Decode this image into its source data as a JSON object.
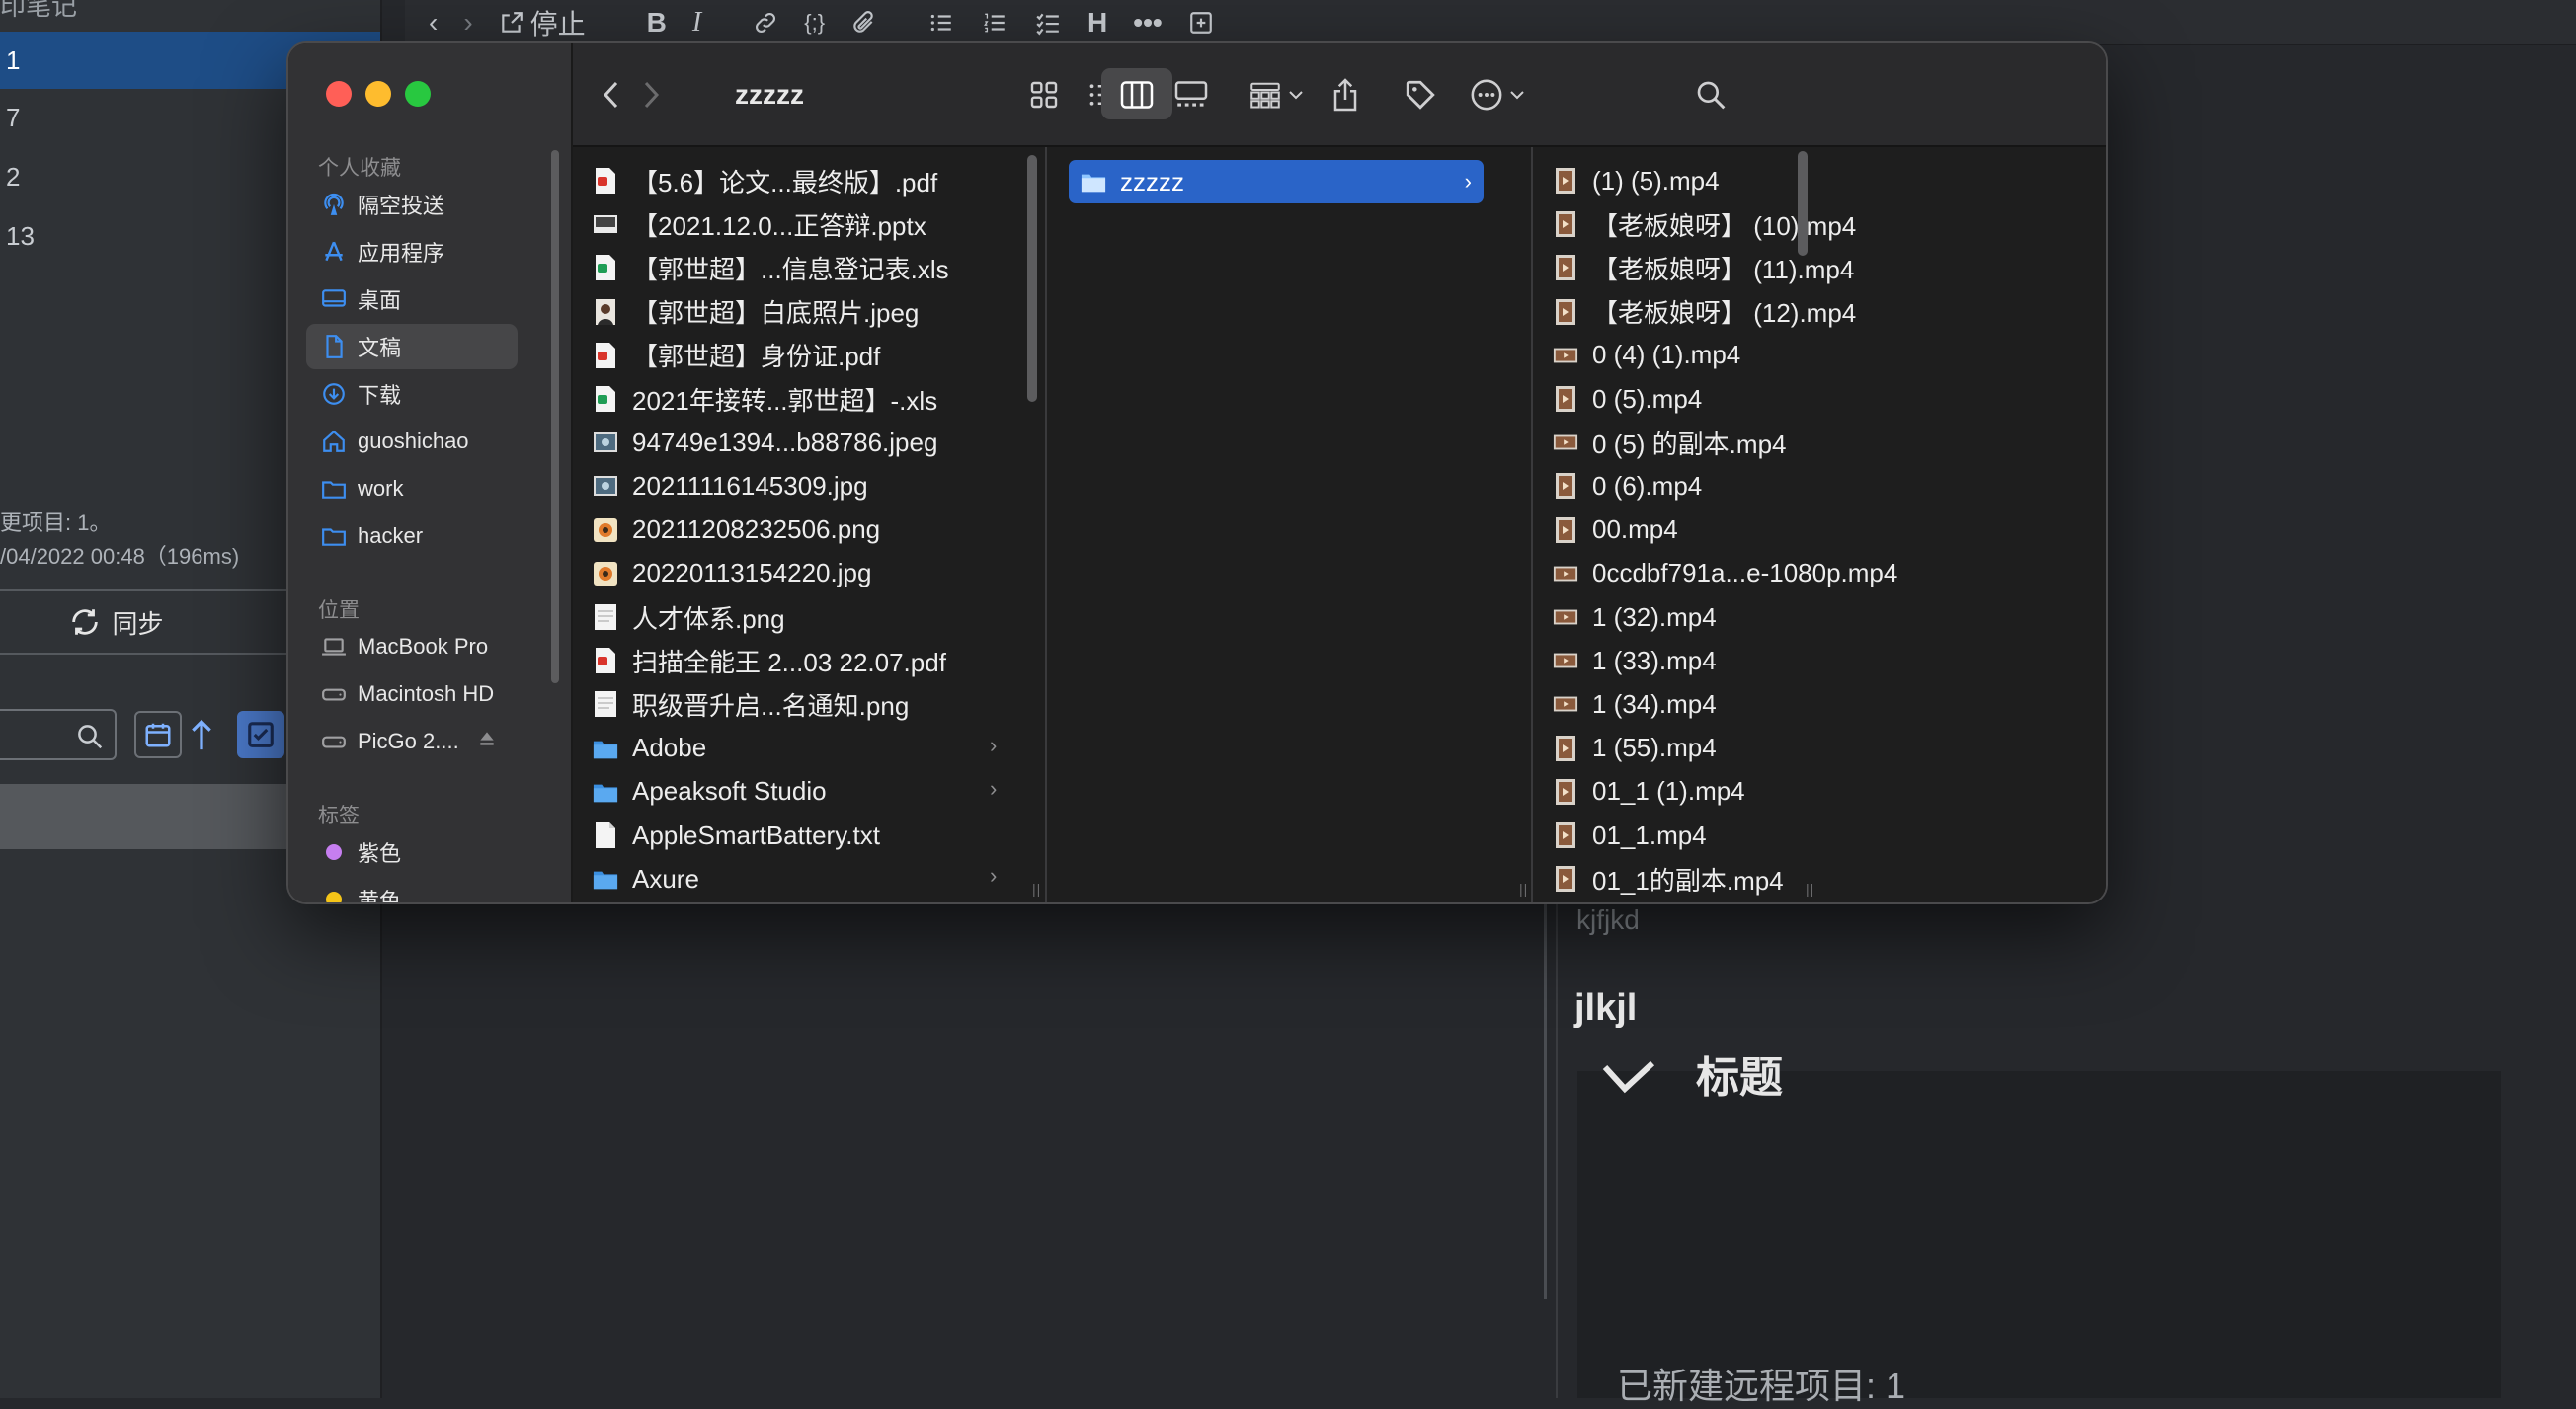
{
  "bg": {
    "top_text": "印笔记",
    "rows": [
      "1",
      "7",
      "2",
      "13"
    ],
    "status_line1": "更项目: 1。",
    "status_line2": "/04/2022 00:48（196ms)",
    "sync_label": "同步",
    "toolbar_stop": "停止",
    "note_text1": "kjfjkd",
    "note_heading": "jlkjl",
    "panel_title": "标题",
    "panel_footer": "已新建远程项目: 1"
  },
  "finder": {
    "title": "zzzzz",
    "sidebar": {
      "section_favorites": "个人收藏",
      "favorites": [
        {
          "label": "隔空投送",
          "icon": "airdrop-icon"
        },
        {
          "label": "应用程序",
          "icon": "applications-icon"
        },
        {
          "label": "桌面",
          "icon": "desktop-icon"
        },
        {
          "label": "文稿",
          "icon": "documents-icon",
          "selected": true
        },
        {
          "label": "下载",
          "icon": "downloads-icon"
        },
        {
          "label": "guoshichao",
          "icon": "home-icon"
        },
        {
          "label": "work",
          "icon": "folder-icon"
        },
        {
          "label": "hacker",
          "icon": "folder-icon"
        }
      ],
      "section_locations": "位置",
      "locations": [
        {
          "label": "MacBook Pro",
          "icon": "laptop-icon"
        },
        {
          "label": "Macintosh HD",
          "icon": "disk-icon"
        },
        {
          "label": "PicGo 2....",
          "icon": "disk-icon",
          "ejectable": true
        }
      ],
      "section_tags": "标签",
      "tags": [
        {
          "label": "紫色",
          "color": "#c67ef0"
        },
        {
          "label": "黄色",
          "color": "#f5c518"
        }
      ]
    },
    "column1": [
      {
        "name": "【5.6】论文...最终版】.pdf",
        "type": "pdf"
      },
      {
        "name": "【2021.12.0...正答辩.pptx",
        "type": "pptx"
      },
      {
        "name": "【郭世超】...信息登记表.xls",
        "type": "xls"
      },
      {
        "name": "【郭世超】白底照片.jpeg",
        "type": "photo"
      },
      {
        "name": "【郭世超】身份证.pdf",
        "type": "pdf"
      },
      {
        "name": "2021年接转...郭世超】-.xls",
        "type": "xls"
      },
      {
        "name": "94749e1394...b88786.jpeg",
        "type": "image"
      },
      {
        "name": "20211116145309.jpg",
        "type": "image"
      },
      {
        "name": "20211208232506.png",
        "type": "image2"
      },
      {
        "name": "20220113154220.jpg",
        "type": "image2"
      },
      {
        "name": "人才体系.png",
        "type": "doc"
      },
      {
        "name": "扫描全能王 2...03 22.07.pdf",
        "type": "pdf"
      },
      {
        "name": "职级晋升启...名通知.png",
        "type": "doc"
      },
      {
        "name": "Adobe",
        "type": "folder",
        "has_children": true
      },
      {
        "name": "Apeaksoft Studio",
        "type": "folder",
        "has_children": true
      },
      {
        "name": "AppleSmartBattery.txt",
        "type": "txt"
      },
      {
        "name": "Axure",
        "type": "folder",
        "has_children": true
      }
    ],
    "column2": [
      {
        "name": "zzzzz",
        "type": "folder",
        "selected": true,
        "has_children": true
      }
    ],
    "column3": [
      "(1) (5).mp4",
      "【老板娘呀】 (10).mp4",
      "【老板娘呀】 (11).mp4",
      "【老板娘呀】 (12).mp4",
      "0 (4) (1).mp4",
      "0 (5).mp4",
      "0 (5) 的副本.mp4",
      "0 (6).mp4",
      "00.mp4",
      "0ccdbf791a...e-1080p.mp4",
      "1 (32).mp4",
      "1 (33).mp4",
      "1 (34).mp4",
      "1 (55).mp4",
      "01_1 (1).mp4",
      "01_1.mp4",
      "01_1的副本.mp4"
    ]
  },
  "colors": {
    "accent": "#2a64c8",
    "close": "#ff5f57",
    "minimize": "#febc2e",
    "zoom": "#28c840",
    "folder": "#5aa9f0"
  }
}
